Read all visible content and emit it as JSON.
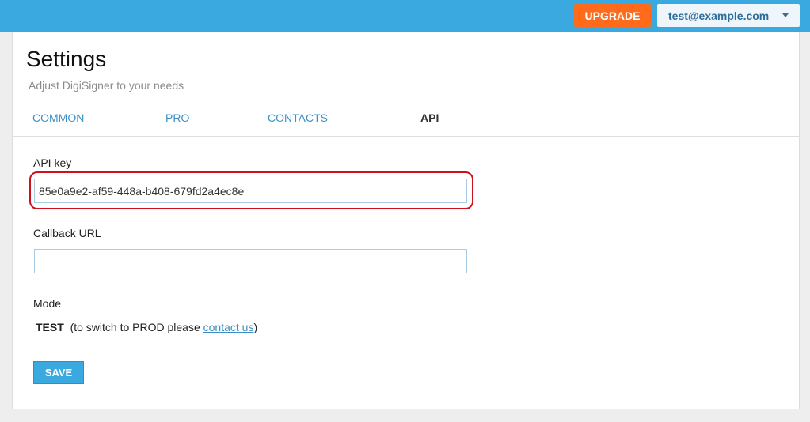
{
  "header": {
    "upgrade_label": "UPGRADE",
    "user_email": "test@example.com"
  },
  "page": {
    "title": "Settings",
    "subtitle": "Adjust DigiSigner to your needs"
  },
  "tabs": [
    {
      "label": "COMMON",
      "active": false
    },
    {
      "label": "PRO",
      "active": false
    },
    {
      "label": "CONTACTS",
      "active": false
    },
    {
      "label": "API",
      "active": true
    }
  ],
  "form": {
    "api_key_label": "API key",
    "api_key_value": "85e0a9e2-af59-448a-b408-679fd2a4ec8e",
    "callback_label": "Callback URL",
    "callback_value": "",
    "mode_label": "Mode",
    "mode_value": "TEST",
    "mode_note_prefix": "(to switch to PROD please ",
    "mode_note_link": "contact us",
    "mode_note_suffix": ")",
    "save_label": "SAVE"
  },
  "colors": {
    "header_bg": "#3aa9e0",
    "upgrade_bg": "#ff6b1a",
    "highlight_border": "#d0111b",
    "link": "#3a8fc6"
  }
}
